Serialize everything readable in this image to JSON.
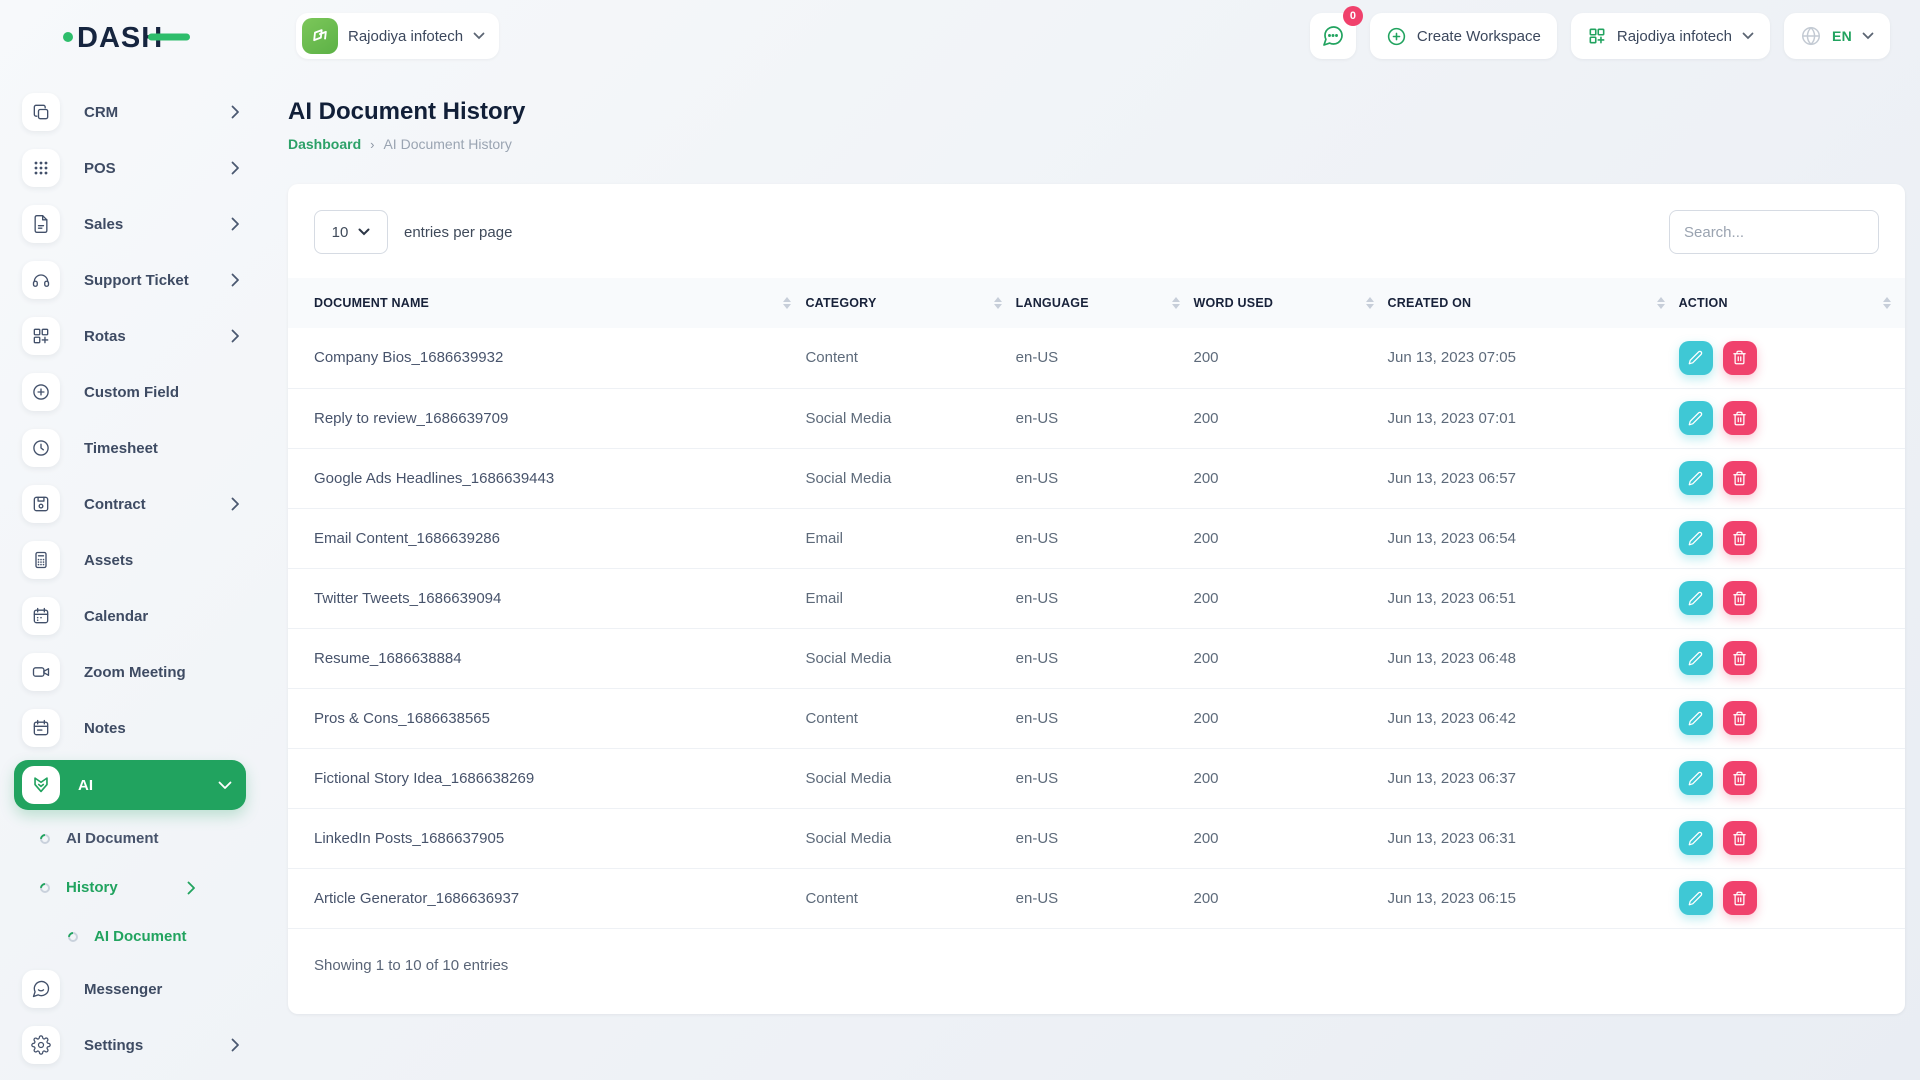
{
  "header": {
    "logo_text": "DASH",
    "workspace_switcher": {
      "label": "Rajodiya infotech"
    },
    "messages_badge": "0",
    "create_workspace_label": "Create Workspace",
    "account_label": "Rajodiya infotech",
    "language_code": "EN"
  },
  "sidebar": {
    "items": [
      {
        "label": "CRM",
        "icon": "crm-icon",
        "type": "main",
        "chevron": "right"
      },
      {
        "label": "POS",
        "icon": "pos-icon",
        "type": "main",
        "chevron": "right"
      },
      {
        "label": "Sales",
        "icon": "sales-icon",
        "type": "main",
        "chevron": "right"
      },
      {
        "label": "Support Ticket",
        "icon": "support-ticket-icon",
        "type": "main",
        "chevron": "right"
      },
      {
        "label": "Rotas",
        "icon": "rotas-icon",
        "type": "main",
        "chevron": "right"
      },
      {
        "label": "Custom Field",
        "icon": "custom-field-icon",
        "type": "main",
        "chevron": null
      },
      {
        "label": "Timesheet",
        "icon": "timesheet-icon",
        "type": "main",
        "chevron": null
      },
      {
        "label": "Contract",
        "icon": "contract-icon",
        "type": "main",
        "chevron": "right"
      },
      {
        "label": "Assets",
        "icon": "assets-icon",
        "type": "main",
        "chevron": null
      },
      {
        "label": "Calendar",
        "icon": "calendar-icon",
        "type": "main",
        "chevron": null
      },
      {
        "label": "Zoom Meeting",
        "icon": "zoom-meeting-icon",
        "type": "main",
        "chevron": null
      },
      {
        "label": "Notes",
        "icon": "notes-icon",
        "type": "main",
        "chevron": null
      },
      {
        "label": "AI",
        "icon": "ai-icon",
        "type": "main",
        "chevron": "down",
        "active": true
      },
      {
        "label": "AI Document",
        "type": "sub"
      },
      {
        "label": "History",
        "type": "sub",
        "active": true,
        "chevron": "right"
      },
      {
        "label": "AI Document",
        "type": "subsub",
        "active": true
      },
      {
        "label": "Messenger",
        "icon": "messenger-icon",
        "type": "main",
        "chevron": null
      },
      {
        "label": "Settings",
        "icon": "settings-icon",
        "type": "main",
        "chevron": "right"
      }
    ]
  },
  "main": {
    "title": "AI Document History",
    "breadcrumb": {
      "home": "Dashboard",
      "current": "AI Document History"
    },
    "controls": {
      "page_size": "10",
      "entries_label": "entries per page",
      "search_placeholder": "Search..."
    },
    "table": {
      "columns": [
        "DOCUMENT NAME",
        "CATEGORY",
        "LANGUAGE",
        "WORD USED",
        "CREATED ON",
        "ACTION"
      ],
      "rows": [
        {
          "name": "Company Bios_1686639932",
          "category": "Content",
          "language": "en-US",
          "words": "200",
          "created": "Jun 13, 2023 07:05"
        },
        {
          "name": "Reply to review_1686639709",
          "category": "Social Media",
          "language": "en-US",
          "words": "200",
          "created": "Jun 13, 2023 07:01"
        },
        {
          "name": "Google Ads Headlines_1686639443",
          "category": "Social Media",
          "language": "en-US",
          "words": "200",
          "created": "Jun 13, 2023 06:57"
        },
        {
          "name": "Email Content_1686639286",
          "category": "Email",
          "language": "en-US",
          "words": "200",
          "created": "Jun 13, 2023 06:54"
        },
        {
          "name": "Twitter Tweets_1686639094",
          "category": "Email",
          "language": "en-US",
          "words": "200",
          "created": "Jun 13, 2023 06:51"
        },
        {
          "name": "Resume_1686638884",
          "category": "Social Media",
          "language": "en-US",
          "words": "200",
          "created": "Jun 13, 2023 06:48"
        },
        {
          "name": "Pros & Cons_1686638565",
          "category": "Content",
          "language": "en-US",
          "words": "200",
          "created": "Jun 13, 2023 06:42"
        },
        {
          "name": "Fictional Story Idea_1686638269",
          "category": "Social Media",
          "language": "en-US",
          "words": "200",
          "created": "Jun 13, 2023 06:37"
        },
        {
          "name": "LinkedIn Posts_1686637905",
          "category": "Social Media",
          "language": "en-US",
          "words": "200",
          "created": "Jun 13, 2023 06:31"
        },
        {
          "name": "Article Generator_1686636937",
          "category": "Content",
          "language": "en-US",
          "words": "200",
          "created": "Jun 13, 2023 06:15"
        }
      ],
      "footer": "Showing 1 to 10 of 10 entries"
    }
  },
  "colors": {
    "primary_green": "#21a35f",
    "logo_green": "#2ebd6b",
    "edit_teal": "#3fc8d5",
    "delete_pink": "#f0416c",
    "badge_pink": "#f0416c"
  }
}
